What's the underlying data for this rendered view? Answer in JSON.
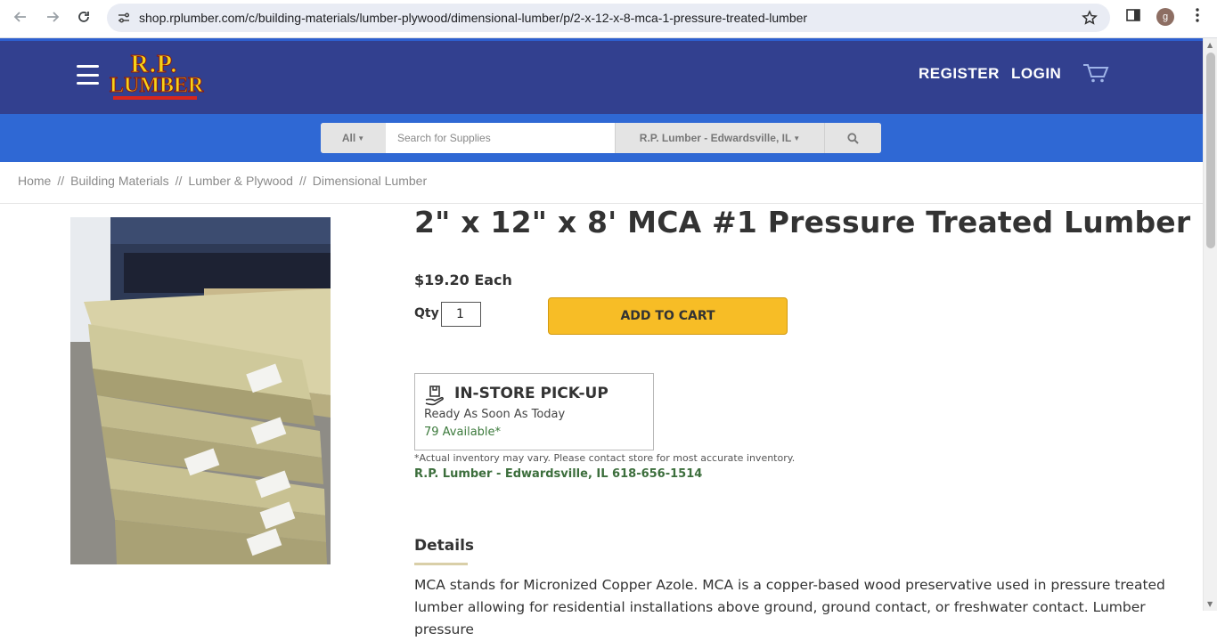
{
  "browser": {
    "url": "shop.rplumber.com/c/building-materials/lumber-plywood/dimensional-lumber/p/2-x-12-x-8-mca-1-pressure-treated-lumber",
    "profile_initial": "g"
  },
  "header": {
    "logo_line1": "R.P.",
    "logo_line2": "LUMBER",
    "register": "REGISTER",
    "login": "LOGIN"
  },
  "search": {
    "category": "All",
    "placeholder": "Search for Supplies",
    "store": "R.P. Lumber - Edwardsville, IL"
  },
  "breadcrumb": [
    "Home",
    "Building Materials",
    "Lumber & Plywood",
    "Dimensional Lumber"
  ],
  "breadcrumb_sep": "//",
  "product": {
    "title": "2\" x 12\" x 8' MCA #1 Pressure Treated Lumber",
    "price": "$19.20 Each",
    "qty_label": "Qty",
    "qty_value": "1",
    "add_to_cart": "ADD TO CART"
  },
  "pickup": {
    "title": "IN-STORE PICK-UP",
    "ready": "Ready As Soon As Today",
    "available": "79 Available*",
    "note": "*Actual inventory may vary. Please contact store for most accurate inventory.",
    "store_line": "R.P. Lumber - Edwardsville, IL 618-656-1514"
  },
  "details": {
    "heading": "Details",
    "text": "MCA stands for Micronized Copper Azole. MCA is a copper-based wood preservative used in pressure treated lumber allowing for residential installations above ground, ground contact, or freshwater contact. Lumber pressure"
  },
  "colors": {
    "header_bg": "#32408f",
    "search_band": "#2f68d4",
    "cart_button": "#f7bd26",
    "available_green": "#3c7a3c"
  }
}
